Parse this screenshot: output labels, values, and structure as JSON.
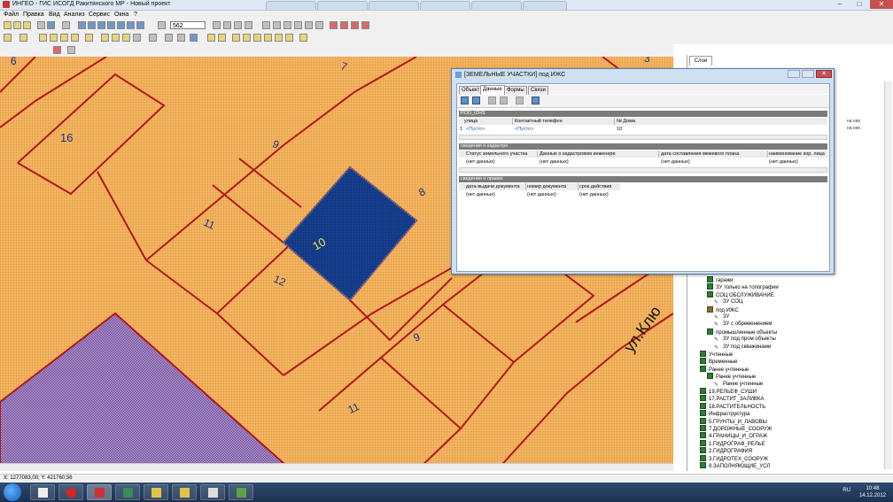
{
  "window": {
    "title": "ИНГЕО - ГИС ИСОГД Ракитянского МР - Новый проект"
  },
  "menu": [
    "Файл",
    "Правка",
    "Вид",
    "Анализ",
    "Сервис",
    "Окна",
    "?"
  ],
  "toolbar": {
    "zoom_value": "562"
  },
  "map": {
    "parcel_labels": [
      "6",
      "7",
      "3",
      "16",
      "9",
      "8",
      "11",
      "10",
      "12",
      "9",
      "11"
    ],
    "street_label": "ул.Клю"
  },
  "dialog": {
    "title": "[ЗЕМЕЛЬНЫЕ УЧАСТКИ] под ИЖС",
    "tabs": [
      "Объект",
      "Данные",
      "Формы",
      "Связи"
    ],
    "active_tab": "Данные",
    "table_name": "POD_IZHS",
    "main_table": {
      "headers": [
        "улица",
        "Контактный телефон",
        "№ Дома"
      ],
      "row_index": "1",
      "cells": [
        "<Пусто>",
        "<Пусто>",
        "10"
      ]
    },
    "cadastre": {
      "section_title": "сведения о кадастре",
      "headers": [
        "Статус земельного участка",
        "Данные о кадастровом инженере",
        "дата составления межевого плана",
        "наименование кор. лица"
      ],
      "cells": [
        "(нет данных)",
        "(нет данных)",
        "(нет данных)",
        "(нет данных)"
      ]
    },
    "rights": {
      "section_title": "сведения о правах",
      "headers": [
        "дата выдачи документа",
        "номер документа",
        "срок действия"
      ],
      "cells": [
        "(нет данных)",
        "(нет данных)",
        "(нет данных)"
      ]
    }
  },
  "right_panel": {
    "tab": "Слои",
    "notes": [
      "на них",
      "на них"
    ],
    "layers": [
      {
        "label": "гаражи",
        "type": "layer",
        "indent": 2
      },
      {
        "label": "ЗУ только на топографии",
        "type": "layer",
        "indent": 2
      },
      {
        "label": "СОЦ ОБСЛУЖИВАНИЕ",
        "type": "layer",
        "indent": 2
      },
      {
        "label": "ЗУ СОЦ",
        "type": "pen",
        "indent": 3
      },
      {
        "label": "под ИЖС",
        "type": "folder",
        "indent": 2
      },
      {
        "label": "ЗУ",
        "type": "pen",
        "indent": 3
      },
      {
        "label": "ЗУ с обременением",
        "type": "pen",
        "indent": 3
      },
      {
        "label": "промышленные объекты",
        "type": "layer",
        "indent": 2
      },
      {
        "label": "ЗУ под пром объекты",
        "type": "pen",
        "indent": 3
      },
      {
        "label": "ЗУ под скважинами",
        "type": "pen",
        "indent": 3
      },
      {
        "label": "Учтенные",
        "type": "layer",
        "indent": 1
      },
      {
        "label": "Временные",
        "type": "layer",
        "indent": 1
      },
      {
        "label": "Ранее учтенные",
        "type": "layer",
        "indent": 1
      },
      {
        "label": "Ранее учтенные",
        "type": "layer",
        "indent": 2
      },
      {
        "label": "Ранее учтенные",
        "type": "pen",
        "indent": 3
      },
      {
        "label": "19.РЕЛЬЕФ_СУШИ",
        "type": "layer",
        "indent": 1
      },
      {
        "label": "17.РАСТИТ_ЗАЛИВКА",
        "type": "layer",
        "indent": 1
      },
      {
        "label": "18.РАСТИТЕЛЬНОСТЬ",
        "type": "layer",
        "indent": 1
      },
      {
        "label": "Инфраструктура",
        "type": "layer",
        "indent": 1
      },
      {
        "label": "5.ГРУНТЫ_И_ЛАВОВЫ",
        "type": "layer",
        "indent": 1
      },
      {
        "label": "7.ДОРОЖНЫЕ_СООРУЖ",
        "type": "layer",
        "indent": 1
      },
      {
        "label": "4.ГРАНИЦЫ_И_ОГРАЖ",
        "type": "layer",
        "indent": 1
      },
      {
        "label": "1.ГИДРОГРАФ_РЕЛЬЕ",
        "type": "layer",
        "indent": 1
      },
      {
        "label": "2.ГИДРОГРАФИЯ",
        "type": "layer",
        "indent": 1
      },
      {
        "label": "3.ГИДРОТЕХ_СООРУЖ",
        "type": "layer",
        "indent": 1
      },
      {
        "label": "8.ЗАПОЛНЯЮЩИЕ_УСЛ",
        "type": "layer",
        "indent": 1
      }
    ]
  },
  "status": {
    "coords": "X: 1277083,00; Y: 421760,56"
  },
  "taskbar": {
    "lang": "RU",
    "time": "10:48",
    "date": "14.12.2012"
  },
  "colors": {
    "parcel_fill": "#f4b661",
    "selected_parcel": "#163f8f",
    "boundary": "#b01818",
    "purple_zone": "#8e6bb0",
    "dialog_frame": "#cfe0f3"
  }
}
